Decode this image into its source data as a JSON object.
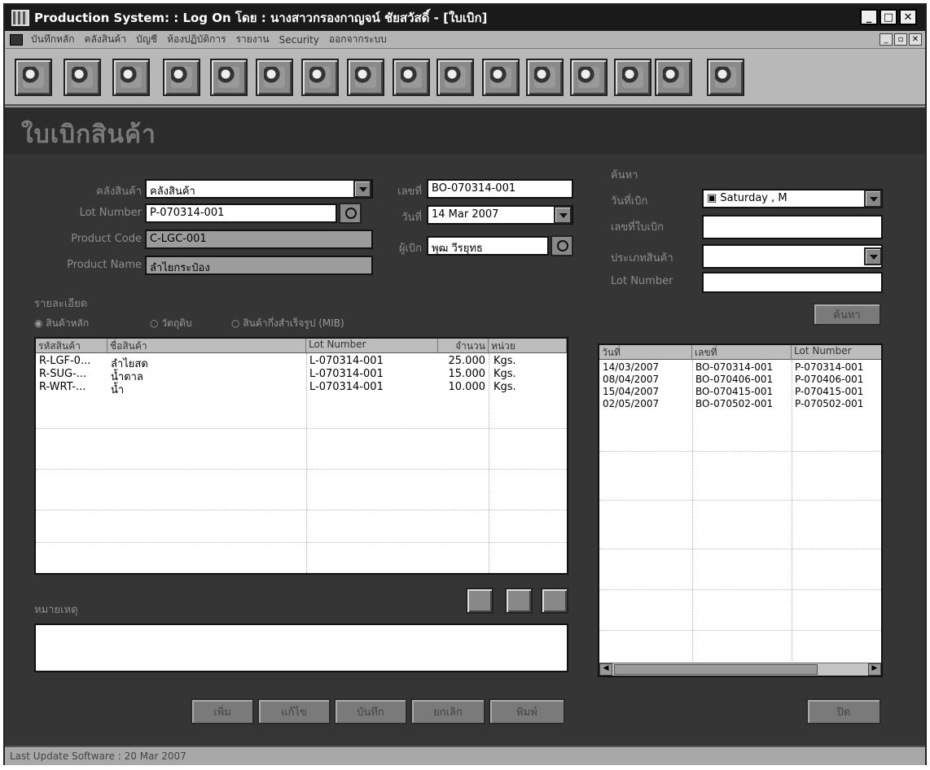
{
  "window": {
    "title": "Production System: : Log On โดย : นางสาวกรองกาญจน์ ชัยสวัสดิ์ - [ใบเบิก]",
    "menu": [
      "บันทึกหลัก",
      "คลังสินค้า",
      "บัญชี",
      "ห้องปฏิบัติการ",
      "รายงาน",
      "Security",
      "ออกจากระบบ"
    ]
  },
  "header": {
    "title": "ใบเบิกสินค้า"
  },
  "form": {
    "warehouse_label": "คลังสินค้า",
    "warehouse_value": "คลังสินค้า",
    "lot_label": "Lot Number",
    "lot_value": "P-070314-001",
    "group_label": "Product Code",
    "group_value": "C-LGC-001",
    "name_label": "Product Name",
    "name_value": "ลำไยกระป๋อง",
    "doc_label": "เลขที่",
    "doc_value": "BO-070314-001",
    "date_label": "วันที่",
    "date_value": "14 Mar 2007",
    "by_label": "ผู้เบิก",
    "by_value": "พุฒ วีรยุทธ"
  },
  "detail": {
    "section_label": "รายละเอียด",
    "radio_1": "สินค้าหลัก",
    "radio_2": "วัตถุดิบ",
    "radio_3": "สินค้ากึ่งสำเร็จรูป (MIB)",
    "columns": [
      "รหัสสินค้า",
      "ชื่อสินค้า",
      "Lot Number",
      "จำนวน",
      "หน่วย"
    ],
    "rows": [
      {
        "code": "R-LGF-0...",
        "name": "ลำไยสด",
        "lot": "L-070314-001",
        "qty": "25.000",
        "unit": "Kgs."
      },
      {
        "code": "R-SUG-...",
        "name": "น้ำตาล",
        "lot": "L-070314-001",
        "qty": "15.000",
        "unit": "Kgs."
      },
      {
        "code": "R-WRT-...",
        "name": "น้ำ",
        "lot": "L-070314-001",
        "qty": "10.000",
        "unit": "Kgs."
      }
    ]
  },
  "remark": {
    "label": "หมายเหตุ"
  },
  "search": {
    "group_label": "ค้นหา",
    "date_label": "วันที่เบิก",
    "date_value": "Saturday   ,   M",
    "doc_label": "เลขที่ใบเบิก",
    "type_label": "ประเภทสินค้า",
    "lot_label": "Lot Number",
    "button": "ค้นหา"
  },
  "history": {
    "columns": [
      "วันที่",
      "เลขที่",
      "Lot Number"
    ],
    "rows": [
      {
        "date": "14/03/2007",
        "doc": "BO-070314-001",
        "lot": "P-070314-001"
      },
      {
        "date": "08/04/2007",
        "doc": "BO-070406-001",
        "lot": "P-070406-001"
      },
      {
        "date": "15/04/2007",
        "doc": "BO-070415-001",
        "lot": "P-070415-001"
      },
      {
        "date": "02/05/2007",
        "doc": "BO-070502-001",
        "lot": "P-070502-001"
      }
    ]
  },
  "actions": [
    "เพิ่ม",
    "แก้ไข",
    "บันทึก",
    "ยกเลิก",
    "พิมพ์"
  ],
  "close_button": "ปิด",
  "status": "Last Update Software : 20 Mar 2007"
}
